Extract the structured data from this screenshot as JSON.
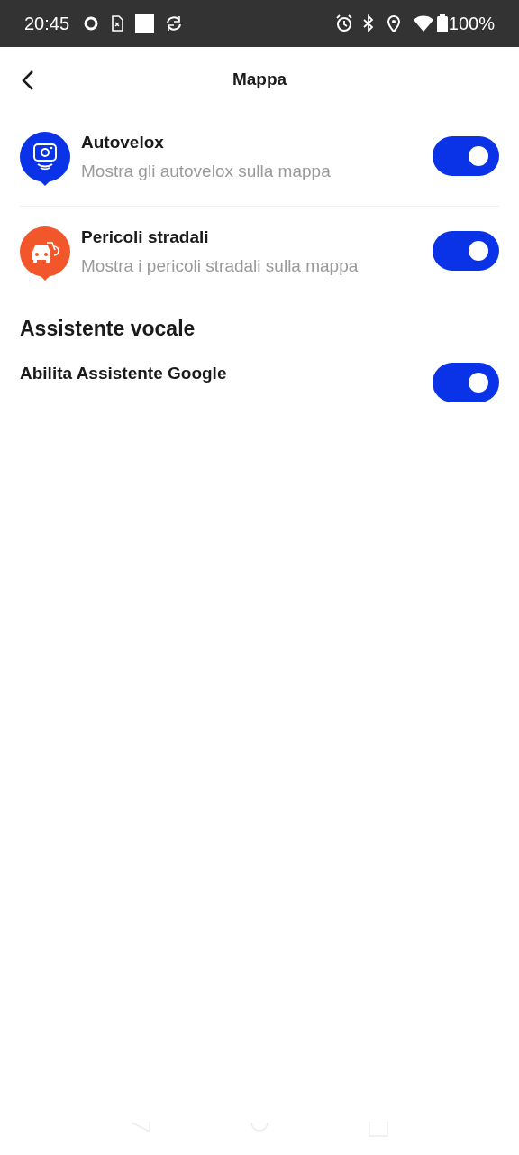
{
  "status_bar": {
    "time": "20:45",
    "battery": "100%"
  },
  "header": {
    "title": "Mappa"
  },
  "map_settings": [
    {
      "kind": "camera",
      "title": "Autovelox",
      "subtitle": "Mostra gli autovelox sulla mappa",
      "on": true,
      "color": "#0a33e8"
    },
    {
      "kind": "hazard",
      "title": "Pericoli stradali",
      "subtitle": "Mostra i pericoli stradali sulla mappa",
      "on": true,
      "color": "#f2572b"
    }
  ],
  "voice_section": {
    "title": "Assistente vocale",
    "items": [
      {
        "title": "Abilita Assistente Google",
        "on": true
      }
    ]
  }
}
